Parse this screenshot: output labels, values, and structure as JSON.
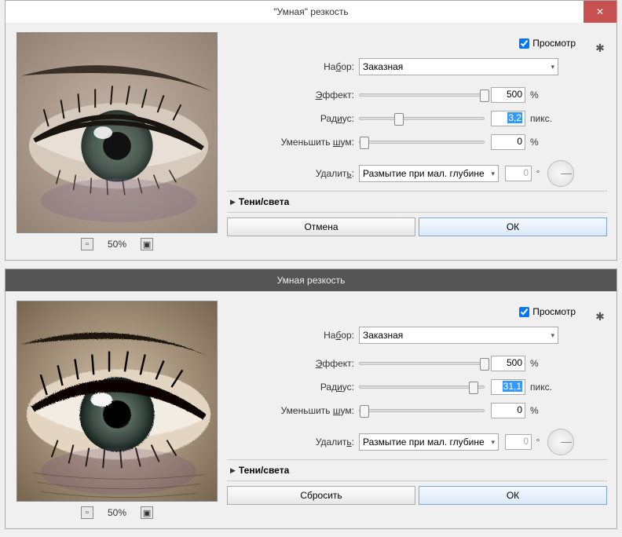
{
  "dialogs": [
    {
      "title": "\"Умная\" резкость",
      "zoom": "50%",
      "previewLabel": "Просмотр",
      "previewChecked": true,
      "setLabelPre": "На",
      "setLabelU": "б",
      "setLabelPost": "ор:",
      "setValue": "Заказная",
      "amountLabelPre": "",
      "amountLabelU": "Э",
      "amountLabelPost": "ффект:",
      "amountValue": "500",
      "amountUnit": "%",
      "amountThumb": "97%",
      "radiusLabelPre": "Рад",
      "radiusLabelU": "и",
      "radiusLabelPost": "ус:",
      "radiusValue": "3,2",
      "radiusUnit": "пикс.",
      "radiusThumb": "28%",
      "noiseLabelPre": "Уменьшить ",
      "noiseLabelU": "ш",
      "noiseLabelPost": "ум:",
      "noiseValue": "0",
      "noiseUnit": "%",
      "noiseThumb": "0%",
      "removeLabelPre": "Удалит",
      "removeLabelU": "ь",
      "removeLabelPost": ":",
      "removeValue": "Размытие при мал. глубине",
      "angleValue": "0",
      "shadowsLabel": "Тени/света",
      "cancel": "Отмена",
      "ok": "ОК",
      "dark": false
    },
    {
      "title": "Умная  резкость",
      "zoom": "50%",
      "previewLabel": "Просмотр",
      "previewChecked": true,
      "setLabelPre": "На",
      "setLabelU": "б",
      "setLabelPost": "ор:",
      "setValue": "Заказная",
      "amountLabelPre": "",
      "amountLabelU": "Э",
      "amountLabelPost": "ффект:",
      "amountValue": "500",
      "amountUnit": "%",
      "amountThumb": "97%",
      "radiusLabelPre": "Рад",
      "radiusLabelU": "и",
      "radiusLabelPost": "ус:",
      "radiusValue": "31,1",
      "radiusUnit": "пикс.",
      "radiusThumb": "88%",
      "noiseLabelPre": "Уменьшить ",
      "noiseLabelU": "ш",
      "noiseLabelPost": "ум:",
      "noiseValue": "0",
      "noiseUnit": "%",
      "noiseThumb": "0%",
      "removeLabelPre": "Удалит",
      "removeLabelU": "ь",
      "removeLabelPost": ":",
      "removeValue": "Размытие при мал. глубине",
      "angleValue": "0",
      "shadowsLabel": "Тени/света",
      "cancel": "Сбросить",
      "ok": "ОК",
      "dark": true
    }
  ]
}
